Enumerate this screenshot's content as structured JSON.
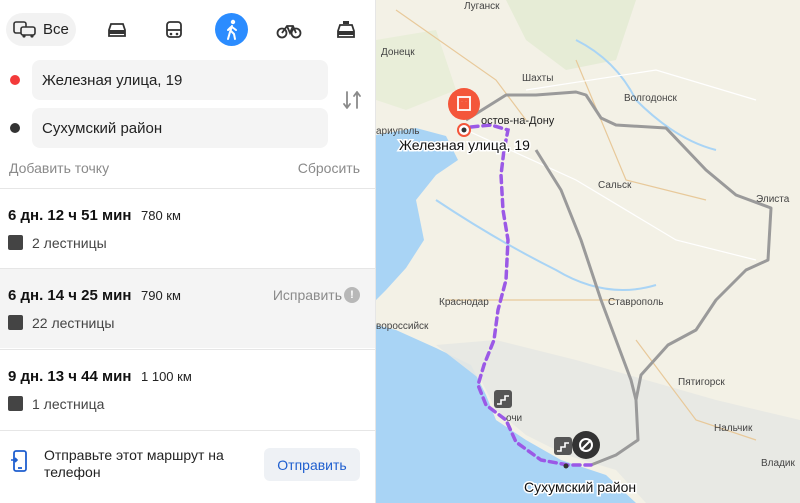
{
  "modes": {
    "all_label": "Все",
    "icons": [
      "car-icon",
      "bus-icon",
      "walk-icon",
      "bike-icon",
      "taxi-icon"
    ],
    "active": "walk-icon",
    "accent": "#2b8cff"
  },
  "route_points": {
    "from": "Железная улица, 19",
    "to": "Сухумский район",
    "from_color": "#f33a3a",
    "to_color": "#333333"
  },
  "actions": {
    "add_point": "Добавить точку",
    "reset": "Сбросить"
  },
  "routes": [
    {
      "time": "6 дн. 12 ч 51 мин",
      "distance": "780 км",
      "stairs": "2 лестницы"
    },
    {
      "time": "6 дн. 14 ч 25 мин",
      "distance": "790 км",
      "stairs": "22 лестницы",
      "issue_label": "Исправить"
    },
    {
      "time": "9 дн. 13 ч 44 мин",
      "distance": "1 100 км",
      "stairs": "1 лестница"
    }
  ],
  "share": {
    "text": "Отправьте этот маршрут на телефон",
    "button": "Отправить"
  },
  "map": {
    "route_color": "#9b59e6",
    "alt_route_color": "#9a9a9a",
    "start_label": "Железная улица, 19",
    "end_label": "Сухумский район",
    "cities": {
      "lugansk": "Луганск",
      "donetsk": "Донецк",
      "shakhty": "Шахты",
      "volgodonsk": "Волгодонск",
      "rostov": "остов-на-Дону",
      "mariupol": "ариуполь",
      "salsk": "Сальск",
      "elista": "Элиста",
      "krasnodar": "Краснодар",
      "stavropol": "Ставрополь",
      "novorossiysk": "воросcийск",
      "pyatigorsk": "Пятигорск",
      "sochi": "очи",
      "nalchik": "Нальчик",
      "vladikavkaz": "Владик"
    }
  }
}
